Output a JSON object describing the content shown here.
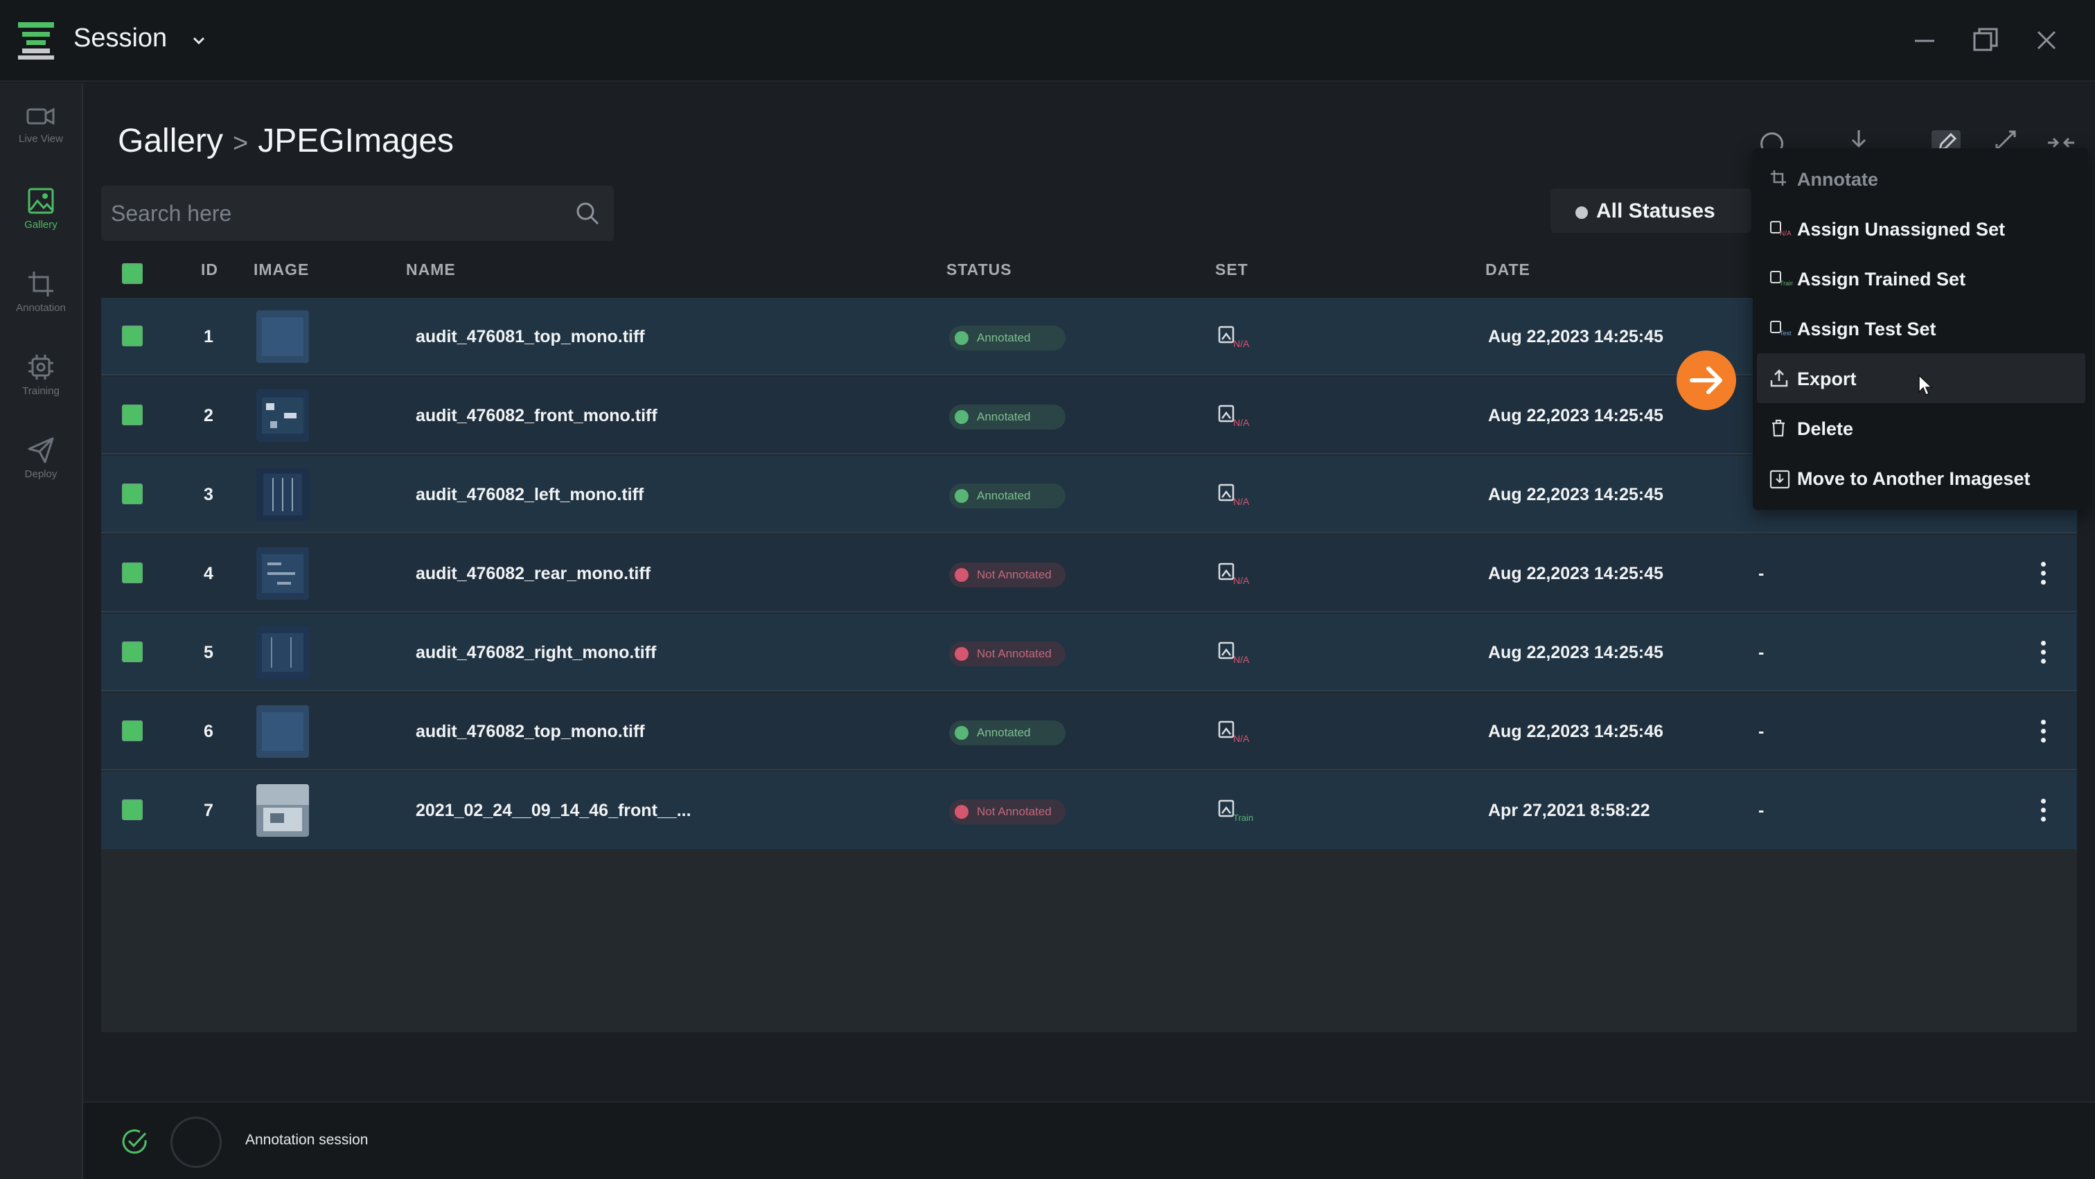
{
  "titlebar": {
    "session_title": "Session"
  },
  "sidebar": {
    "items": [
      {
        "label": "Live View",
        "icon": "video-camera-icon"
      },
      {
        "label": "Gallery",
        "icon": "image-icon",
        "active": true
      },
      {
        "label": "Annotation",
        "icon": "crop-icon"
      },
      {
        "label": "Training",
        "icon": "chip-icon"
      },
      {
        "label": "Deploy",
        "icon": "paper-plane-icon"
      }
    ]
  },
  "breadcrumb": {
    "root": "Gallery",
    "separator": ">",
    "current": "JPEGImages"
  },
  "search": {
    "placeholder": "Search here"
  },
  "filter": {
    "status_label": "All Statuses"
  },
  "table": {
    "headers": {
      "id": "ID",
      "image": "IMAGE",
      "name": "NAME",
      "status": "STATUS",
      "set": "SET",
      "date": "DATE"
    },
    "rows": [
      {
        "id": "1",
        "name": "audit_476081_top_mono.tiff",
        "status": "Annotated",
        "set": "N/A",
        "date": "Aug 22,2023 14:25:45",
        "extra": ""
      },
      {
        "id": "2",
        "name": "audit_476082_front_mono.tiff",
        "status": "Annotated",
        "set": "N/A",
        "date": "Aug 22,2023 14:25:45",
        "extra": ""
      },
      {
        "id": "3",
        "name": "audit_476082_left_mono.tiff",
        "status": "Annotated",
        "set": "N/A",
        "date": "Aug 22,2023 14:25:45",
        "extra": ""
      },
      {
        "id": "4",
        "name": "audit_476082_rear_mono.tiff",
        "status": "Not Annotated",
        "set": "N/A",
        "date": "Aug 22,2023 14:25:45",
        "extra": "-"
      },
      {
        "id": "5",
        "name": "audit_476082_right_mono.tiff",
        "status": "Not Annotated",
        "set": "N/A",
        "date": "Aug 22,2023 14:25:45",
        "extra": "-"
      },
      {
        "id": "6",
        "name": "audit_476082_top_mono.tiff",
        "status": "Annotated",
        "set": "N/A",
        "date": "Aug 22,2023 14:25:46",
        "extra": "-"
      },
      {
        "id": "7",
        "name": "2021_02_24__09_14_46_front__...",
        "status": "Not Annotated",
        "set": "Train",
        "date": "Apr 27,2021 8:58:22",
        "extra": "-"
      }
    ]
  },
  "context_menu": {
    "items": [
      {
        "label": "Annotate",
        "icon": "crop-icon",
        "disabled": true
      },
      {
        "label": "Assign Unassigned Set",
        "icon": "set-na-icon"
      },
      {
        "label": "Assign Trained Set",
        "icon": "set-train-icon"
      },
      {
        "label": "Assign Test Set",
        "icon": "set-test-icon"
      },
      {
        "label": "Export",
        "icon": "upload-icon",
        "hovered": true
      },
      {
        "label": "Delete",
        "icon": "trash-icon"
      },
      {
        "label": "Move to Another Imageset",
        "icon": "move-icon"
      }
    ]
  },
  "footer": {
    "session_text": "Annotation session"
  },
  "colors": {
    "accent_green": "#4fbf66",
    "status_red": "#d5566f",
    "cta_orange": "#f57f29",
    "row_bg": "#213443"
  }
}
